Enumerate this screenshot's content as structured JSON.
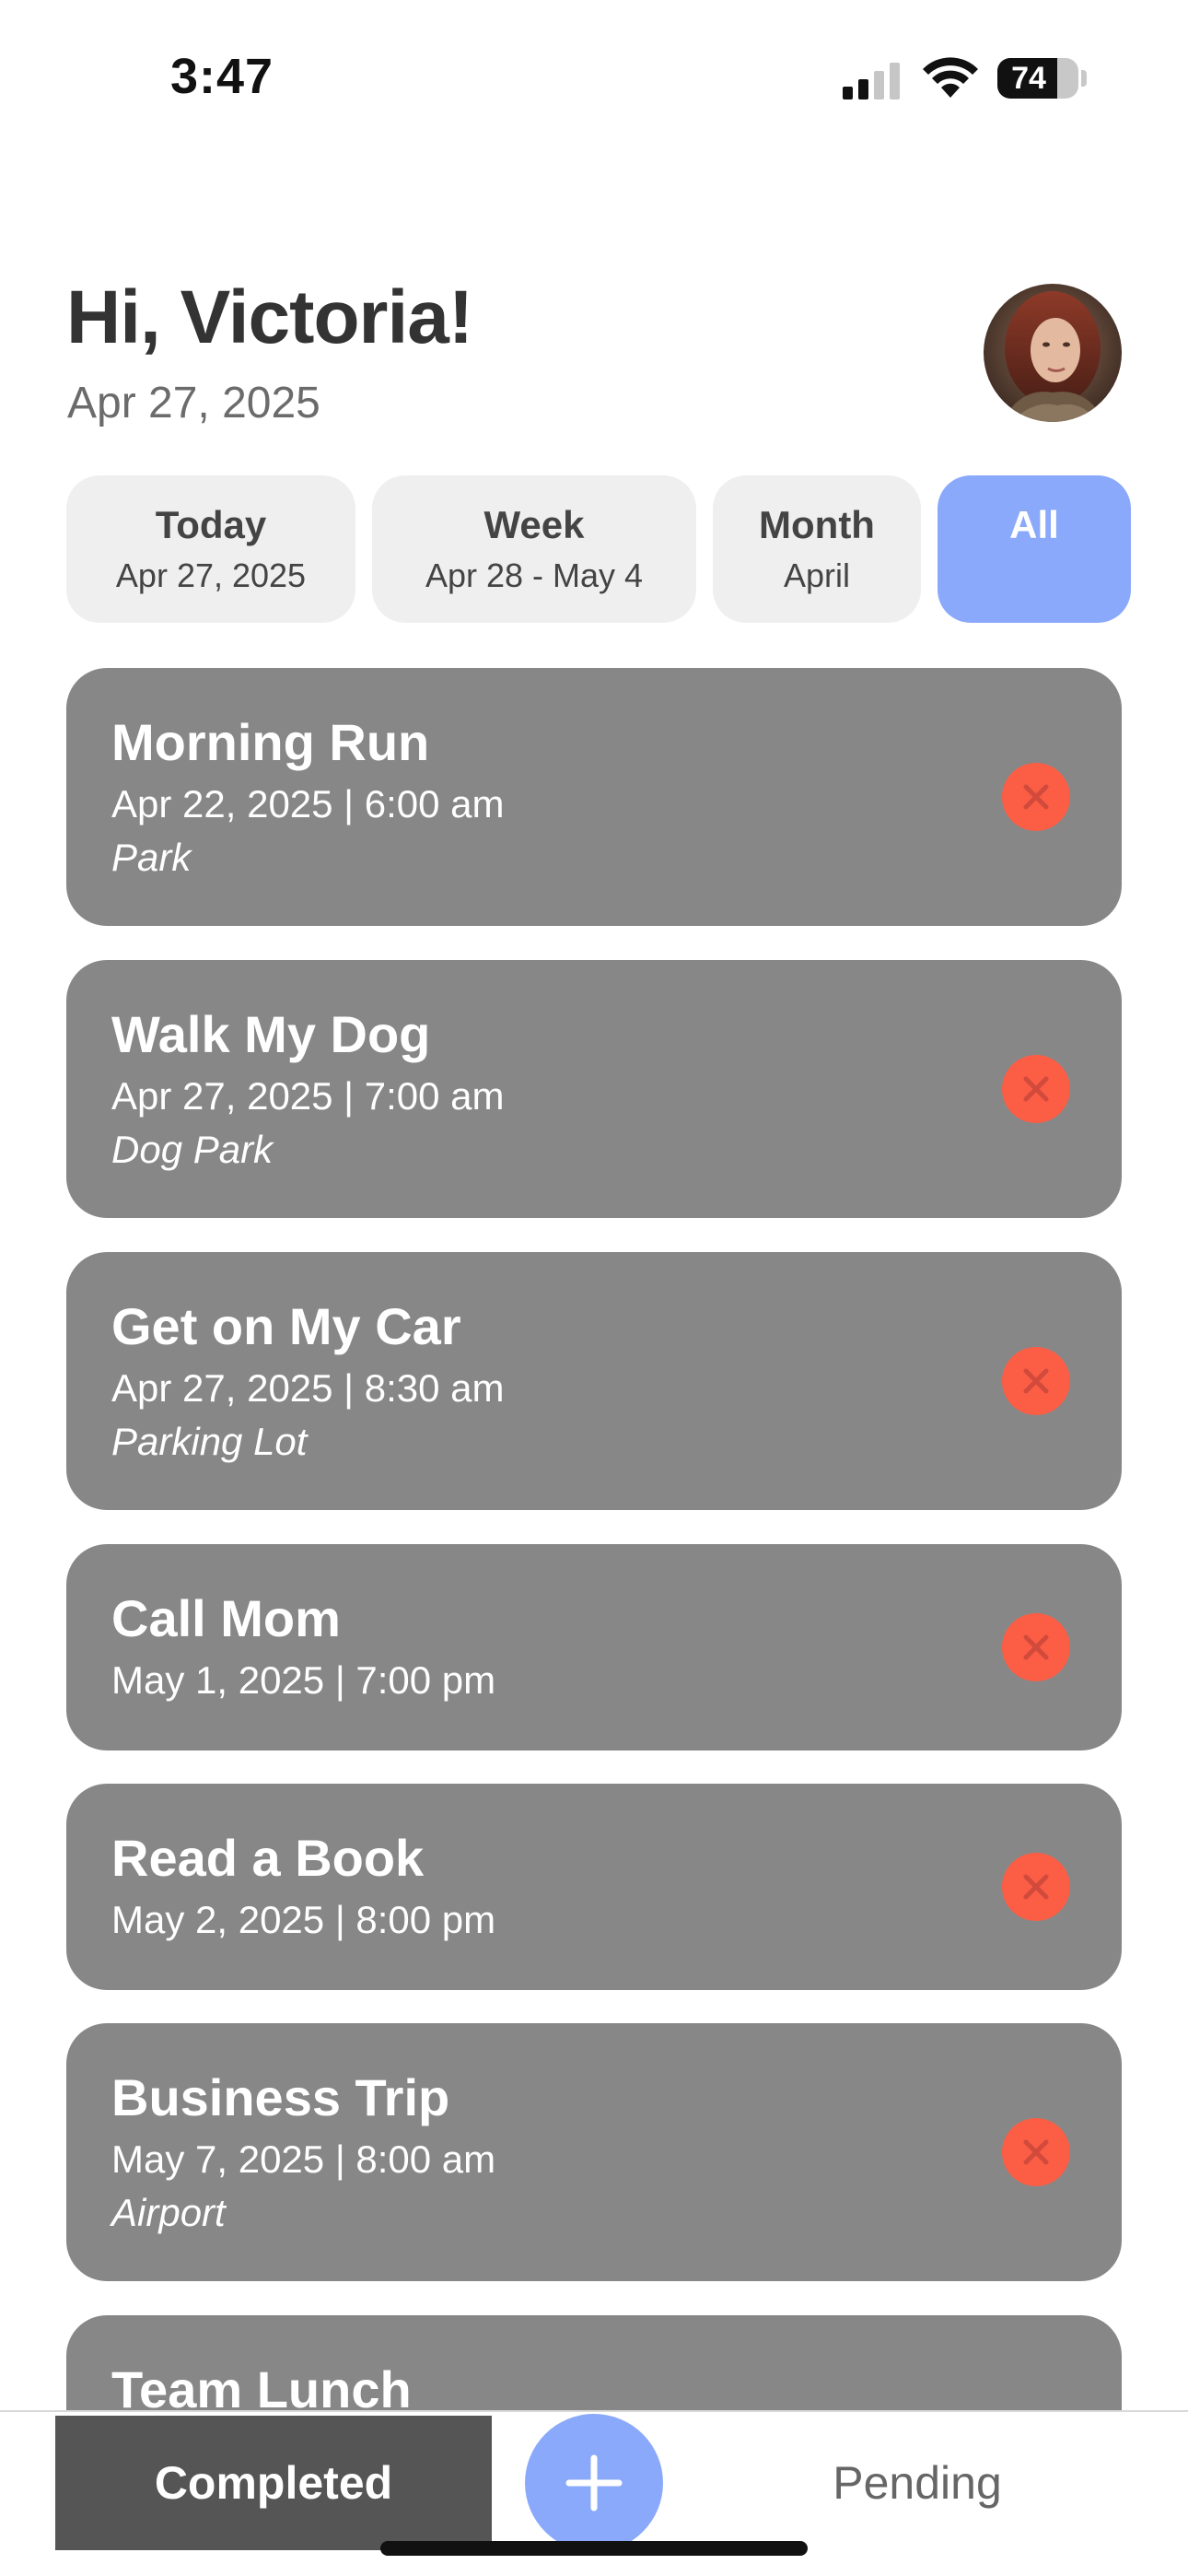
{
  "status_bar": {
    "time": "3:47",
    "battery_percent": "74",
    "battery_level": 0.74,
    "icons": [
      "cellular-signal-icon",
      "wifi-icon",
      "battery-icon"
    ]
  },
  "header": {
    "greeting": "Hi, Victoria!",
    "date": "Apr 27, 2025",
    "avatar": "user-avatar-photo"
  },
  "filters": [
    {
      "label": "Today",
      "sub": "Apr 27, 2025",
      "selected": false
    },
    {
      "label": "Week",
      "sub": "Apr 28 - May 4",
      "selected": false
    },
    {
      "label": "Month",
      "sub": "April",
      "selected": false
    },
    {
      "label": "All",
      "sub": "",
      "selected": true
    }
  ],
  "tasks": [
    {
      "title": "Morning Run",
      "datetime": "Apr 22, 2025 | 6:00 am",
      "location": "Park"
    },
    {
      "title": "Walk My Dog",
      "datetime": "Apr 27, 2025 | 7:00 am",
      "location": "Dog Park"
    },
    {
      "title": "Get on My Car",
      "datetime": "Apr 27, 2025 | 8:30 am",
      "location": "Parking Lot"
    },
    {
      "title": "Call Mom",
      "datetime": "May 1, 2025 | 7:00 pm",
      "location": ""
    },
    {
      "title": "Read a Book",
      "datetime": "May 2, 2025 | 8:00 pm",
      "location": ""
    },
    {
      "title": "Business Trip",
      "datetime": "May 7, 2025 | 8:00 am",
      "location": "Airport"
    },
    {
      "title": "Team Lunch",
      "datetime": "",
      "location": ""
    }
  ],
  "bottom_nav": {
    "completed_label": "Completed",
    "pending_label": "Pending",
    "add_icon": "plus-icon"
  },
  "colors": {
    "accent": "#8ba9fb",
    "card": "#878787",
    "delete": "#fb5e45",
    "completed_tab": "#555555"
  }
}
